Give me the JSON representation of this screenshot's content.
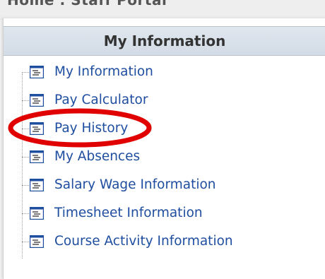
{
  "top_strip": {
    "text": "Home : Staff Portal"
  },
  "panel": {
    "title": "My Information"
  },
  "menu": {
    "items": [
      {
        "label": "My Information",
        "icon": "document-icon"
      },
      {
        "label": "Pay Calculator",
        "icon": "document-icon"
      },
      {
        "label": "Pay History",
        "icon": "document-icon",
        "highlighted": true
      },
      {
        "label": "My Absences",
        "icon": "document-icon"
      },
      {
        "label": "Salary Wage Information",
        "icon": "document-icon"
      },
      {
        "label": "Timesheet Information",
        "icon": "document-icon"
      },
      {
        "label": "Course Activity Information",
        "icon": "document-icon"
      }
    ]
  },
  "colors": {
    "link": "#1f4ea0",
    "header_bg": "#d9e1ea",
    "highlight": "#e00000"
  }
}
